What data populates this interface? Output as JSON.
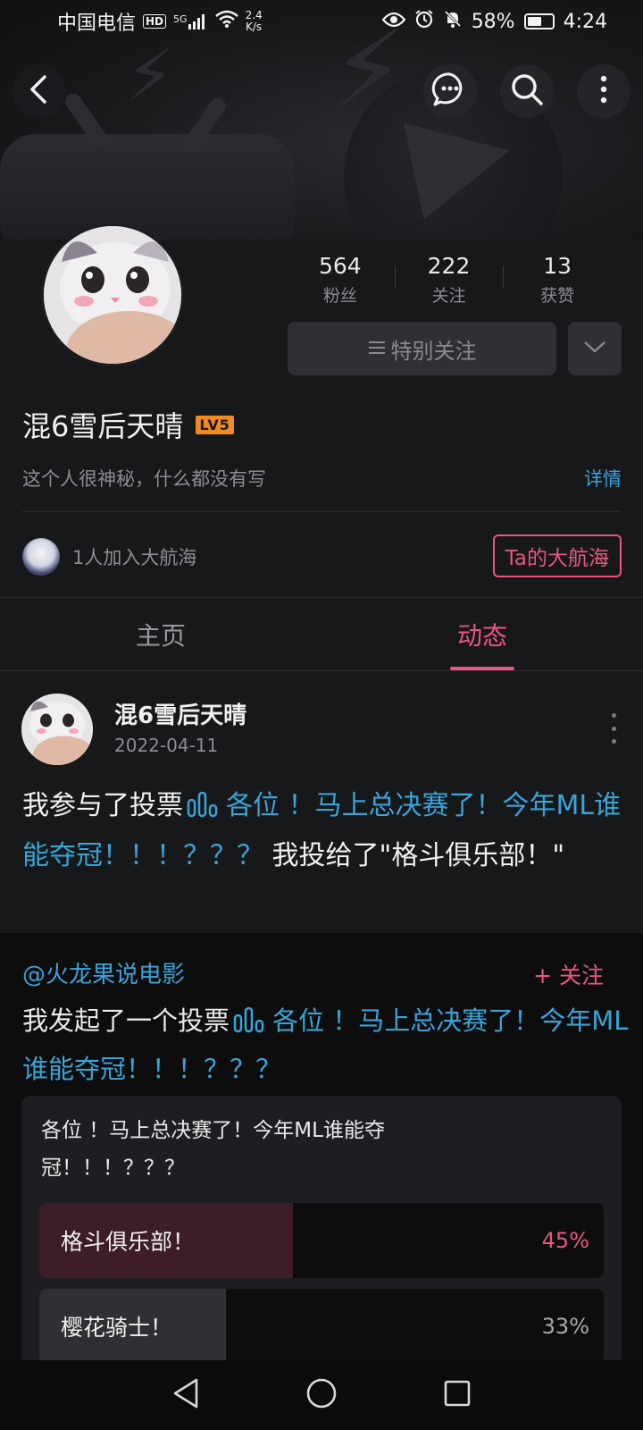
{
  "status_bar": {
    "carrier": "中国电信",
    "hd": "HD",
    "network": "5G",
    "net_speed_value": "2.4",
    "net_speed_unit": "K/s",
    "battery_percent": "58%",
    "battery_level": 0.58,
    "time": "4:24"
  },
  "header": {
    "back_icon": "back-arrow-icon",
    "message_icon": "chat-bubble-icon",
    "search_icon": "search-icon",
    "more_icon": "more-vertical-icon"
  },
  "profile": {
    "stats": [
      {
        "value": "564",
        "label": "粉丝"
      },
      {
        "value": "222",
        "label": "关注"
      },
      {
        "value": "13",
        "label": "获赞"
      }
    ],
    "follow_button": "特别关注",
    "follow_icon": "list-icon",
    "name": "混6雪后天晴",
    "level": "LV5",
    "bio": "这个人很神秘，什么都没有写",
    "detail_link": "详情",
    "crew_text": "1人加入大航海",
    "crew_button": "Ta的大航海"
  },
  "tabs": [
    {
      "label": "主页",
      "active": false
    },
    {
      "label": "动态",
      "active": true
    }
  ],
  "post": {
    "author": "混6雪后天晴",
    "date": "2022-04-11",
    "text_prefix": "我参与了投票",
    "text_vote_title": "各位 ！马上总决赛了！今年ML谁能夺冠！！！？？？",
    "text_suffix": " 我投给了\"格斗俱乐部！\""
  },
  "repost": {
    "user": "@火龙果说电影",
    "follow_label": "+ 关注",
    "text_prefix": "我发起了一个投票",
    "text_vote_title": "各位 ！马上总决赛了！今年ML谁能夺冠！！！？？？",
    "poll": {
      "title": "各位 ！马上总决赛了！今年ML谁能夺冠！！！？？？",
      "options": [
        {
          "label": "格斗俱乐部！",
          "percent": "45%",
          "value": 0.45,
          "voted": true
        },
        {
          "label": "樱花骑士！",
          "percent": "33%",
          "value": 0.33,
          "voted": false
        }
      ]
    }
  },
  "colors": {
    "accent_pink": "#e8577e",
    "link_blue": "#3aa3d8",
    "background": "#17181a"
  }
}
